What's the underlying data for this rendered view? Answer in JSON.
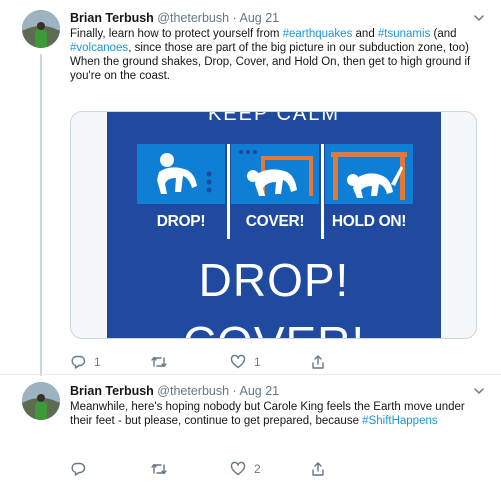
{
  "tweets": [
    {
      "author_name": "Brian Terbush",
      "handle": "@theterbush",
      "dot": "·",
      "date": "Aug 21",
      "text_parts": {
        "p1": "Finally, learn how to protect yourself from ",
        "tag_earthquakes": "#earthquakes",
        "p2": " and ",
        "tag_tsunamis": "#tsunamis",
        "p3": " (and ",
        "tag_volcanoes": "#volcanoes",
        "p4": ", since those are part of the big picture in our subduction zone, too)",
        "p5": "When the ground shakes, Drop, Cover, and Hold On, then get to high ground if you're on the coast."
      },
      "media": {
        "top_text": "KEEP CALM",
        "panel_labels": [
          "DROP!",
          "COVER!",
          "HOLD ON!"
        ],
        "big_line_1": "DROP!",
        "big_line_2": "COVER!"
      },
      "actions": {
        "reply_count": "1",
        "retweet_count": "",
        "like_count": "1"
      }
    },
    {
      "author_name": "Brian Terbush",
      "handle": "@theterbush",
      "dot": "·",
      "date": "Aug 21",
      "text_parts": {
        "p1": "Meanwhile, here's hoping nobody but Carole King feels the Earth move under their feet - but please, continue to get prepared, because ",
        "tag_shift": "#ShiftHappens"
      },
      "actions": {
        "reply_count": "",
        "retweet_count": "",
        "like_count": "2"
      }
    }
  ],
  "icons": {
    "caret": "chevron-down-icon",
    "reply": "reply-icon",
    "retweet": "retweet-icon",
    "like": "heart-icon",
    "share": "share-icon"
  },
  "colors": {
    "link": "#1b95e0",
    "muted": "#657786",
    "poster_blue": "#1f4aa0",
    "panel_blue": "#0e7fd4",
    "table_orange": "#e0793a"
  }
}
